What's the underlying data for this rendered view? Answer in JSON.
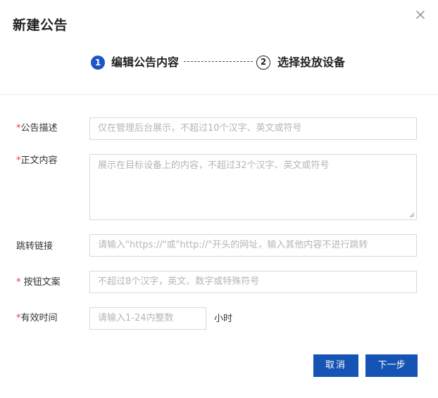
{
  "dialog": {
    "title": "新建公告",
    "close_icon": "close-icon"
  },
  "steps": [
    {
      "number": "1",
      "label": "编辑公告内容",
      "status": "active"
    },
    {
      "number": "2",
      "label": "选择投放设备",
      "status": "pending"
    }
  ],
  "form": {
    "description": {
      "required_mark": "*",
      "label": "公告描述",
      "placeholder": "仅在管理后台展示，不超过10个汉字、英文或符号",
      "value": ""
    },
    "body": {
      "required_mark": "*",
      "label": "正文内容",
      "placeholder": "展示在目标设备上的内容，不超过32个汉字、英文或符号",
      "value": ""
    },
    "link": {
      "label": "跳转链接",
      "placeholder": "请输入\"https://\"或\"http://\"开头的网址，输入其他内容不进行跳转",
      "value": ""
    },
    "button_text": {
      "required_mark": "*",
      "label": " 按钮文案",
      "placeholder": "不超过8个汉字，英文、数字或特殊符号",
      "value": ""
    },
    "duration": {
      "required_mark": "*",
      "label": "有效时间",
      "placeholder": "请输入1-24内整数",
      "value": "",
      "unit": "小时"
    }
  },
  "footer": {
    "cancel_label": "取消",
    "next_label": "下一步"
  },
  "colors": {
    "primary": "#1553b4",
    "step_active": "#1a56c7",
    "required": "#e0393e",
    "border": "#d9d9d9",
    "placeholder": "#b5b5b5"
  }
}
